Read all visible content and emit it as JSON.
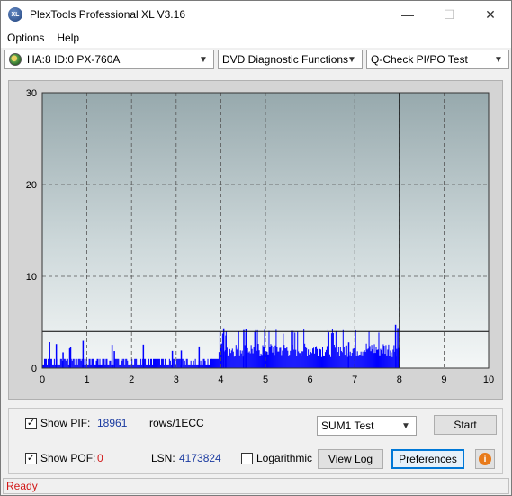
{
  "window": {
    "title": "PlexTools Professional XL V3.16",
    "icon_text": "XL",
    "minimize": "—",
    "maximize": "☐",
    "close": "✕"
  },
  "menu": {
    "items": [
      {
        "label": "Options"
      },
      {
        "label": "Help"
      }
    ]
  },
  "toolbar": {
    "drive": "HA:8 ID:0  PX-760A",
    "function": "DVD Diagnostic Functions",
    "test": "Q-Check PI/PO Test"
  },
  "chart_data": {
    "type": "bar",
    "x_ticks": [
      "0",
      "1",
      "2",
      "3",
      "4",
      "5",
      "6",
      "7",
      "8",
      "9",
      "10"
    ],
    "y_ticks": [
      "0",
      "10",
      "20",
      "30"
    ],
    "xlim": [
      0,
      10
    ],
    "ylim": [
      0,
      30
    ],
    "threshold_line": 4,
    "end_marker_x": 8,
    "grid": true,
    "series_color": "#0000ff",
    "segments": [
      {
        "from": 0.0,
        "to": 3.8,
        "base": 1,
        "peak": 3,
        "sparse_spikes": [
          0.15,
          0.3,
          0.45,
          0.6,
          0.62,
          0.9,
          1.55,
          1.6,
          2.25,
          2.9,
          3.1,
          3.5
        ]
      },
      {
        "from": 3.75,
        "to": 3.95,
        "base": 1,
        "peak": 1,
        "sparse_spikes": []
      },
      {
        "from": 3.95,
        "to": 7.98,
        "base": 2,
        "peak": 4.8,
        "sparse_spikes": [
          4.0,
          4.05,
          4.1,
          4.5,
          4.55,
          6.85,
          7.9,
          7.95
        ]
      }
    ]
  },
  "controls": {
    "show_pif_label": "Show PIF:",
    "show_pif_checked": true,
    "pif_value": "18961",
    "rows_label": "rows/1ECC",
    "show_pof_label": "Show POF:",
    "show_pof_checked": true,
    "pof_value": "0",
    "lsn_label": "LSN:",
    "lsn_value": "4173824",
    "logarithmic_label": "Logarithmic",
    "logarithmic_checked": false,
    "sum_select": "SUM1 Test",
    "start_button": "Start",
    "view_log_button": "View Log",
    "preferences_button": "Preferences",
    "info_glyph": "i"
  },
  "status": {
    "text": "Ready"
  }
}
